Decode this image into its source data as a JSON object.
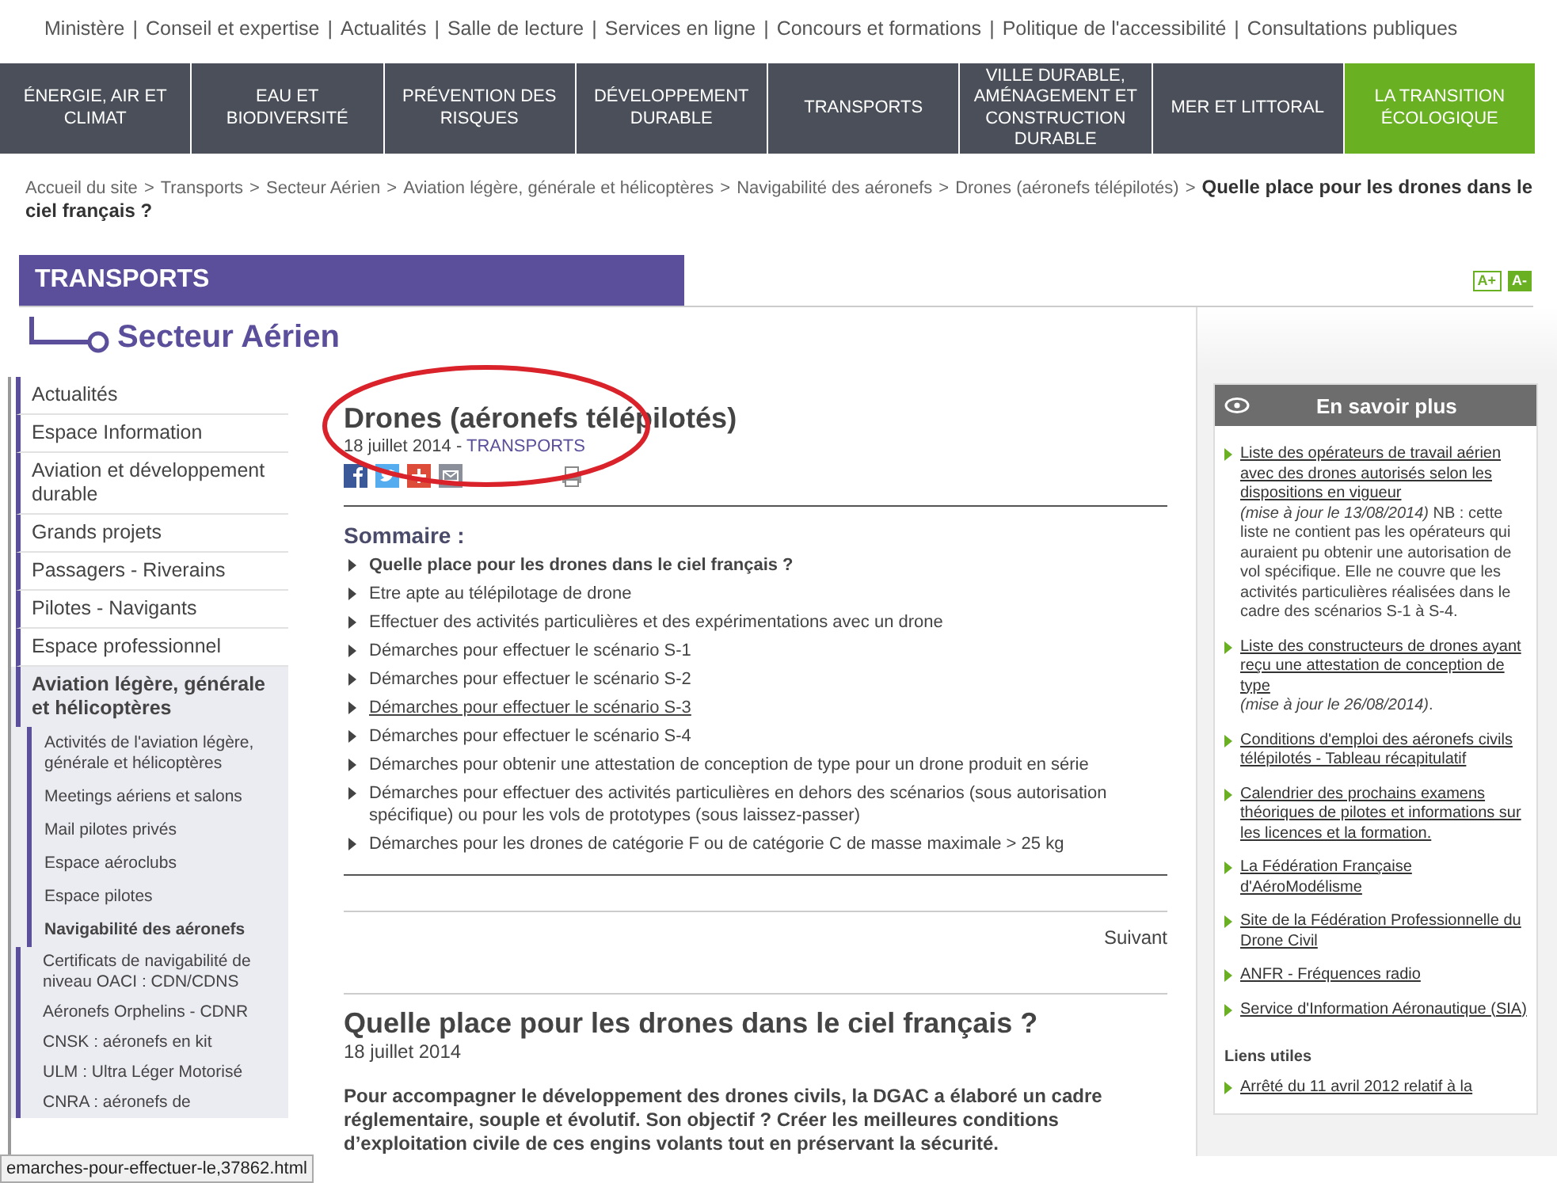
{
  "top_links": [
    "Ministère",
    "Conseil et expertise",
    "Actualités",
    "Salle de lecture",
    "Services en ligne",
    "Concours et formations",
    "Politique de l'accessibilité",
    "Consultations publiques"
  ],
  "top_separator": "|",
  "main_nav": [
    {
      "label": "ÉNERGIE, AIR ET CLIMAT",
      "color": "#4a4f59"
    },
    {
      "label": "EAU ET BIODIVERSITÉ",
      "color": "#4a4f59"
    },
    {
      "label": "PRÉVENTION DES RISQUES",
      "color": "#4a4f59"
    },
    {
      "label": "DÉVELOPPEMENT DURABLE",
      "color": "#4a4f59"
    },
    {
      "label": "TRANSPORTS",
      "color": "#4a4f59"
    },
    {
      "label": "VILLE DURABLE, AMÉNAGEMENT ET CONSTRUCTION DURABLE",
      "color": "#4a4f59"
    },
    {
      "label": "MER ET LITTORAL",
      "color": "#4a4f59"
    },
    {
      "label": "LA TRANSITION ÉCOLOGIQUE",
      "color": "#6ab023"
    }
  ],
  "breadcrumb": {
    "links": [
      "Accueil du site",
      "Transports",
      "Secteur Aérien",
      "Aviation légère, générale et hélicoptères",
      "Navigabilité des aéronefs",
      "Drones (aéronefs télépilotés)"
    ],
    "separator": ">",
    "current": "Quelle place pour les drones dans le ciel français ?"
  },
  "text_size_buttons": [
    "A+",
    "A-"
  ],
  "section_banner": "TRANSPORTS",
  "section_title": "Secteur Aérien",
  "sidebar": {
    "items": [
      {
        "label": "Actualités",
        "selected": false
      },
      {
        "label": "Espace Information",
        "selected": false
      },
      {
        "label": "Aviation et développement durable",
        "selected": false
      },
      {
        "label": "Grands projets",
        "selected": false
      },
      {
        "label": "Passagers - Riverains",
        "selected": false
      },
      {
        "label": "Pilotes - Navigants",
        "selected": false
      },
      {
        "label": "Espace professionnel",
        "selected": false
      },
      {
        "label": "Aviation légère, générale et hélicoptères",
        "selected": true,
        "children": [
          {
            "label": "Activités de l'aviation légère, générale et hélicoptères",
            "selected": false
          },
          {
            "label": "Meetings aériens et salons",
            "selected": false
          },
          {
            "label": "Mail pilotes privés",
            "selected": false
          },
          {
            "label": "Espace aéroclubs",
            "selected": false
          },
          {
            "label": "Espace pilotes",
            "selected": false
          },
          {
            "label": "Navigabilité des aéronefs",
            "selected": true,
            "children": [
              {
                "label": "Certificats de navigabilité de niveau OACI : CDN/CDNS",
                "selected": false
              },
              {
                "label": "Aéronefs Orphelins - CDNR",
                "selected": false
              },
              {
                "label": "CNSK : aéronefs en kit",
                "selected": false
              },
              {
                "label": "ULM : Ultra Léger Motorisé",
                "selected": false
              },
              {
                "label": "CNRA : aéronefs de",
                "selected": false
              }
            ]
          }
        ]
      }
    ]
  },
  "article": {
    "title": "Drones (aéronefs télépilotés)",
    "date": "18 juillet 2014 -",
    "category": "TRANSPORTS",
    "summary_title": "Sommaire :",
    "summary": [
      {
        "label": "Quelle place pour les drones dans le ciel français ?",
        "current": true,
        "hovered": false
      },
      {
        "label": "Etre apte au télépilotage de drone",
        "current": false,
        "hovered": false
      },
      {
        "label": "Effectuer des activités particulières et des expérimentations avec un drone",
        "current": false,
        "hovered": false
      },
      {
        "label": "Démarches pour effectuer le scénario S-1",
        "current": false,
        "hovered": false
      },
      {
        "label": "Démarches pour effectuer le scénario S-2",
        "current": false,
        "hovered": false
      },
      {
        "label": "Démarches pour effectuer le scénario S-3",
        "current": false,
        "hovered": true
      },
      {
        "label": "Démarches pour effectuer le scénario S-4",
        "current": false,
        "hovered": false
      },
      {
        "label": "Démarches pour obtenir une attestation de conception de type pour un drone produit en série",
        "current": false,
        "hovered": false
      },
      {
        "label": "Démarches pour effectuer des activités particulières en dehors des scénarios (sous autorisation spécifique) ou pour les vols de prototypes (sous laissez-passer)",
        "current": false,
        "hovered": false
      },
      {
        "label": "Démarches pour les drones de catégorie F ou de catégorie C de masse maximale > 25 kg",
        "current": false,
        "hovered": false
      }
    ],
    "next": "Suivant",
    "section_heading": "Quelle place pour les drones dans le ciel français ?",
    "section_date": "18 juillet 2014",
    "intro": "Pour accompagner le développement des drones civils, la DGAC a élaboré un cadre réglementaire, souple et évolutif. Son objectif ? Créer les meilleures conditions d’exploitation civile de ces engins volants tout en préservant la sécurité."
  },
  "related": {
    "title": "En savoir plus",
    "items": [
      {
        "link": "Liste des opérateurs de travail aérien avec des drones autorisés selon les dispositions en vigueur",
        "note": "*(mise à jour le 13/08/2014)* NB : cette liste ne contient pas les opérateurs qui auraient pu obtenir une autorisation de vol spécifique. Elle ne couvre que les activités particulières réalisées dans le cadre des scénarios S-1 à  S-4."
      },
      {
        "link": "Liste des constructeurs de drones ayant reçu une attestation de conception de type",
        "note": "*(mise à jour le 26/08/2014)*."
      },
      {
        "link": "Conditions d'emploi des aéronefs civils télépilotés - Tableau récapitulatif"
      },
      {
        "link": "Calendrier des prochains examens théoriques de pilotes et informations sur les licences et la formation."
      },
      {
        "link": "La Fédération Française d'AéroModélisme"
      },
      {
        "link": "Site de la Fédération Professionnelle du Drone Civil"
      },
      {
        "link": "ANFR - Fréquences radio"
      },
      {
        "link": "Service d'Information Aéronautique (SIA)"
      }
    ],
    "useful_title": "Liens utiles",
    "useful_items": [
      {
        "link": "Arrêté du 11 avril 2012 relatif à la"
      }
    ]
  },
  "status_bar": "emarches-pour-effectuer-le,37862.html"
}
